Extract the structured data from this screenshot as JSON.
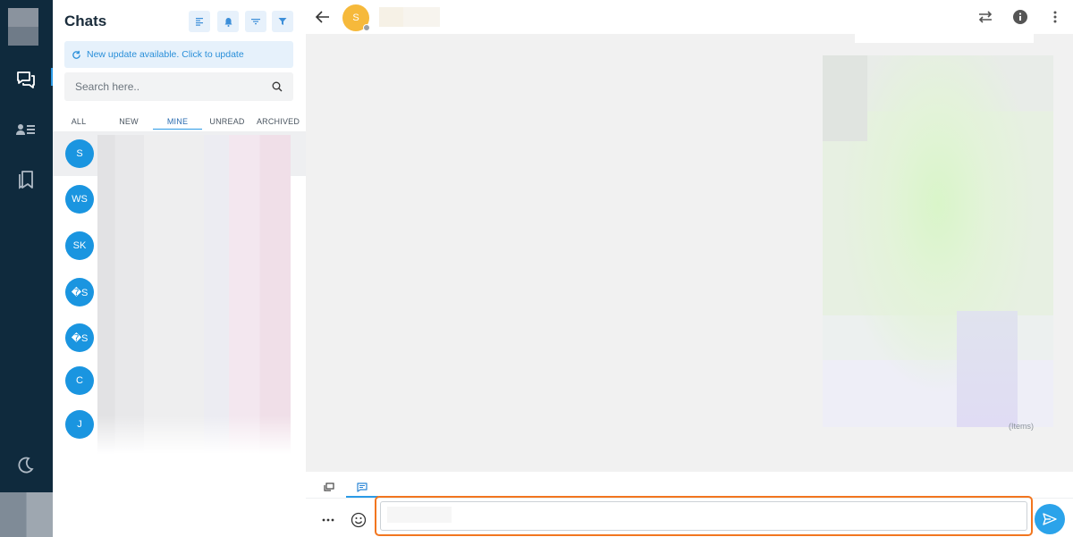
{
  "sidebar": {
    "items": [
      {
        "icon": "chat-bubbles-icon",
        "active": true
      },
      {
        "icon": "contacts-icon",
        "active": false
      },
      {
        "icon": "bookmarks-icon",
        "active": false
      }
    ],
    "theme_icon": "moon-icon"
  },
  "chat_list": {
    "title": "Chats",
    "header_buttons": [
      "align-left-icon",
      "bell-alert-icon",
      "sort-icon",
      "filter-icon"
    ],
    "update_banner": "New update available. Click to update",
    "search": {
      "placeholder": "Search here..",
      "value": ""
    },
    "tabs": [
      {
        "label": "ALL",
        "active": false
      },
      {
        "label": "NEW",
        "active": false
      },
      {
        "label": "MINE",
        "active": true
      },
      {
        "label": "UNREAD",
        "active": false
      },
      {
        "label": "ARCHIVED",
        "active": false
      }
    ],
    "conversations": [
      {
        "initials": "S",
        "selected": true
      },
      {
        "initials": "WS",
        "selected": false
      },
      {
        "initials": "SK",
        "selected": false
      },
      {
        "initials": "�S",
        "selected": false
      },
      {
        "initials": "�S",
        "selected": false
      },
      {
        "initials": "C",
        "selected": false
      },
      {
        "initials": "J",
        "selected": false
      }
    ]
  },
  "conversation": {
    "contact_initial": "S",
    "contact_avatar_color": "#f6b93b",
    "status": "offline",
    "message_meta": "(Items)"
  },
  "composer": {
    "tabs": [
      "chat-windows-icon",
      "message-icon"
    ],
    "active_tab": 1,
    "input": {
      "value": "",
      "placeholder": ""
    },
    "highlight_color": "#f2761f"
  },
  "colors": {
    "rail": "#0f2a3d",
    "accent": "#1a95e0",
    "send": "#2ba3ea"
  }
}
